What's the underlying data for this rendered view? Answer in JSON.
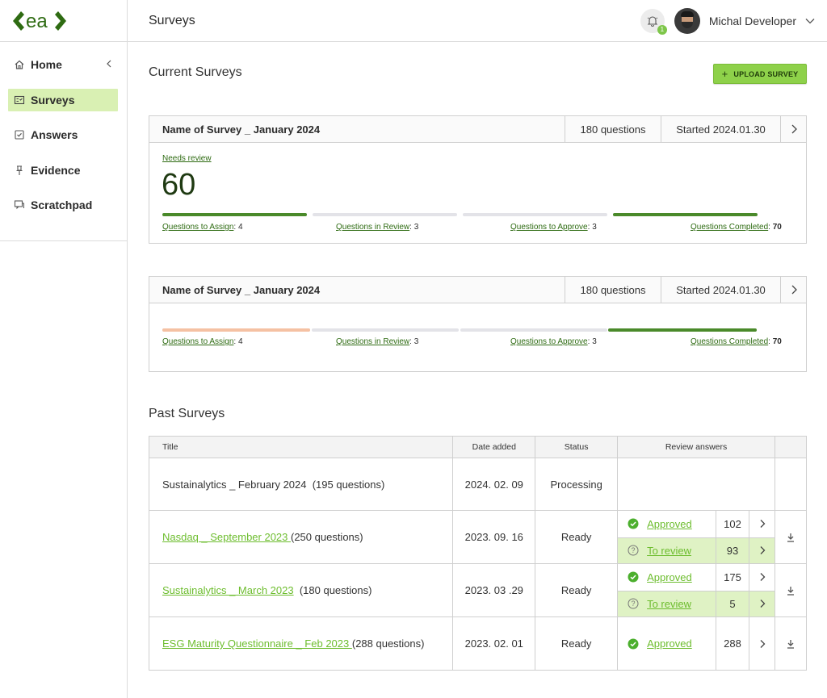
{
  "app": {
    "logo_text": "ea"
  },
  "sidebar": {
    "items": [
      {
        "label": "Home",
        "icon": "home-icon",
        "active": false
      },
      {
        "label": "Surveys",
        "icon": "survey-icon",
        "active": true
      },
      {
        "label": "Answers",
        "icon": "checkbox-icon",
        "active": false
      },
      {
        "label": "Evidence",
        "icon": "pin-icon",
        "active": false
      },
      {
        "label": "Scratchpad",
        "icon": "chat-icon",
        "active": false
      }
    ]
  },
  "header": {
    "title": "Surveys",
    "notifications": "1",
    "user_name": "Michal Developer"
  },
  "current": {
    "title": "Current Surveys",
    "upload_label": "UPLOAD SURVEY",
    "surveys": [
      {
        "name": "Name of Survey _ January 2024",
        "questions": "180 questions",
        "started": "Started 2024.01.30",
        "needs_review_label": "Needs review",
        "needs_review_value": "60",
        "stats": [
          {
            "label": "Questions to Assign",
            "value": "4"
          },
          {
            "label": "Questions in Review",
            "value": "3"
          },
          {
            "label": "Questions to Approve",
            "value": "3"
          },
          {
            "label": "Questions Completed",
            "value": "70"
          }
        ]
      },
      {
        "name": "Name of Survey _ January 2024",
        "questions": "180 questions",
        "started": "Started 2024.01.30",
        "stats": [
          {
            "label": "Questions to Assign",
            "value": "4"
          },
          {
            "label": "Questions in Review",
            "value": "3"
          },
          {
            "label": "Questions to Approve",
            "value": "3"
          },
          {
            "label": "Questions Completed",
            "value": "70"
          }
        ]
      }
    ]
  },
  "past": {
    "title": "Past Surveys",
    "columns": [
      "Title",
      "Date added",
      "Status",
      "Review answers"
    ],
    "rows": [
      {
        "title": "Sustainalytics _ February 2024",
        "questions": "(195 questions)",
        "date": "2024. 02. 09",
        "status": "Processing"
      },
      {
        "title": "Nasdaq _ September 2023 ",
        "questions": "(250 questions)",
        "date": "2023. 09. 16",
        "status": "Ready",
        "approved_label": "Approved",
        "approved": "102",
        "review_label": "To review",
        "review": "93"
      },
      {
        "title": "Sustainalytics _ March 2023",
        "questions": "(180 questions)",
        "date": "2023. 03 .29",
        "status": "Ready",
        "approved_label": "Approved",
        "approved": "175",
        "review_label": "To review",
        "review": "5"
      },
      {
        "title": "ESG Maturity Questionnaire _ Feb 2023 ",
        "questions": "(288 questions)",
        "date": "2023. 02. 01",
        "status": "Ready",
        "approved_label": "Approved",
        "approved": "288"
      }
    ]
  },
  "colors": {
    "accent": "#8ed14a",
    "brand_dark": "#2e6b12",
    "link": "#6dbd2e",
    "progress_green": "#4a8a2a",
    "progress_orange": "#f5c1a3",
    "review_bg": "#dff2c4"
  }
}
